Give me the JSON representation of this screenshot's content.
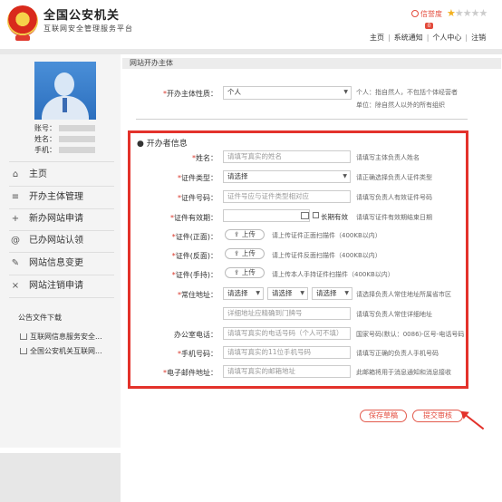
{
  "header": {
    "site_title": "全国公安机关",
    "site_subtitle": "互联网安全管理服务平台",
    "credit_label": "信誉度",
    "star_rating": 1,
    "star_max": 5,
    "notice_badge": "0",
    "nav": [
      "主页",
      "系统通知",
      "个人中心",
      "注销"
    ],
    "accent_color": "#e34b3c"
  },
  "sidebar": {
    "account_label": "账号：",
    "name_label": "姓名：",
    "phone_label": "手机：",
    "items": [
      {
        "icon": "⌂",
        "label": "主页"
      },
      {
        "icon": "≡",
        "label": "开办主体管理"
      },
      {
        "icon": "+",
        "label": "新办网站申请"
      },
      {
        "icon": "@",
        "label": "已办网站认领"
      },
      {
        "icon": "✎",
        "label": "网站信息变更"
      },
      {
        "icon": "×",
        "label": "网站注销申请"
      }
    ],
    "notice_title": "公告文件下载",
    "notices": [
      "互联网信息服务安全...",
      "全国公安机关互联网..."
    ]
  },
  "main": {
    "tab_title": "网站开办主体",
    "owner_label": "开办主体性质：",
    "owner_value": "个人",
    "owner_hint1": "个人：指自然人，不包括个体经营者",
    "owner_hint2": "单位：除自然人以外的所有组织",
    "section_title": "开办者信息",
    "name_label": "姓名：",
    "name_placeholder": "请填写真实的姓名",
    "name_hint": "请填写主体负责人姓名",
    "idtype_label": "证件类型：",
    "idtype_value": "请选择",
    "idtype_hint": "请正确选择负责人证件类型",
    "idno_label": "证件号码：",
    "idno_placeholder": "证件号应与证件类型相对应",
    "idno_hint": "请填写负责人有效证件号码",
    "validity_label": "证件有效期：",
    "longterm_label": "长期有效",
    "validity_hint": "请填写证件有效期结束日期",
    "front_label": "证件(正面)：",
    "front_hint": "请上传证件正面扫描件（400KB以内）",
    "back_label": "证件(反面)：",
    "back_hint": "请上传证件反面扫描件（400KB以内）",
    "hold_label": "证件(手持)：",
    "hold_hint": "请上传本人手持证件扫描件（400KB以内）",
    "upload_label": "上传",
    "address_label": "常住地址：",
    "address_selects": [
      "请选择",
      "请选择",
      "请选择"
    ],
    "address_hint": "请选择负责人常住地址所属省市区",
    "address_detail_placeholder": "详细地址应精确到门牌号",
    "address_detail_hint": "请填写负责人常住详细地址",
    "office_label": "办公室电话：",
    "office_placeholder": "请填写真实的电话号码（个人可不填）",
    "office_hint": "国家号码(默认：0086)-区号-电话号码",
    "mobile_label": "手机号码：",
    "mobile_placeholder": "请填写真实的11位手机号码",
    "mobile_hint": "请填写正确的负责人手机号码",
    "email_label": "电子邮件地址：",
    "email_placeholder": "请填写真实的邮箱地址",
    "email_hint": "此邮箱将用于消息通知和消息接收",
    "save_draft": "保存草稿",
    "submit": "提交审核"
  }
}
